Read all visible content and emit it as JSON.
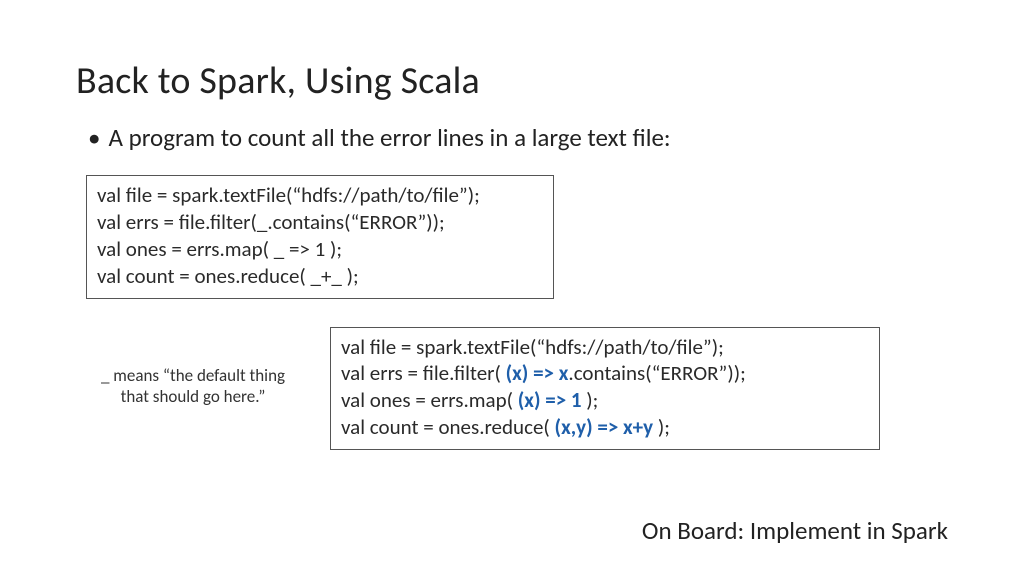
{
  "title": "Back to Spark, Using Scala",
  "bullet": "A program to count all the error lines in a large text file:",
  "code1": {
    "l1": "val file = spark.textFile(“hdfs://path/to/file”);",
    "l2": "val errs = file.filter(_.contains(“ERROR”));",
    "l3": "val ones = errs.map( _ => 1 );",
    "l4": "val count = ones.reduce( _+_ );"
  },
  "sidenote": {
    "l1": "_ means “the default thing",
    "l2": "that should go here.”"
  },
  "code2": {
    "l1": "val file = spark.textFile(“hdfs://path/to/file”);",
    "l2a": "val errs = file.filter( ",
    "l2h": "(x) => x",
    "l2b": ".contains(“ERROR”));",
    "l3a": "val ones = errs.map( ",
    "l3h": "(x) => 1",
    "l3b": " );",
    "l4a": "val count = ones.reduce( ",
    "l4h": "(x,y) => x+y",
    "l4b": " );"
  },
  "footer": "On Board: Implement in Spark"
}
